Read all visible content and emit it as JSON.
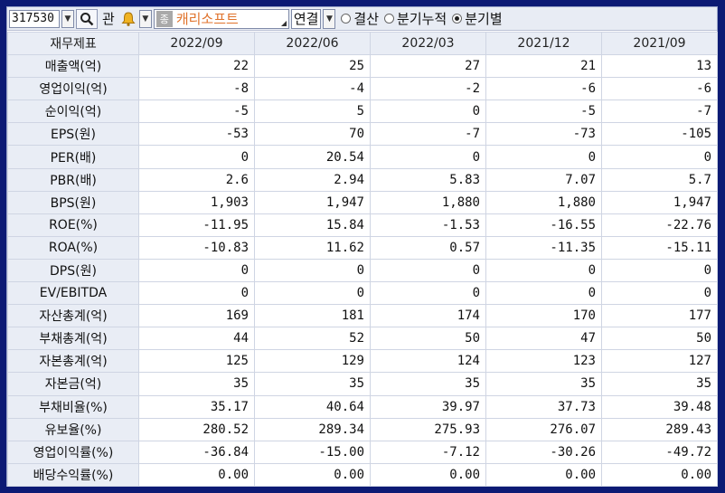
{
  "toolbar": {
    "stock_code": "317530",
    "gwan_label": "관",
    "tag_label": "종",
    "company_name": "캐리소프트",
    "consolidated_label": "연결",
    "radio_options": [
      {
        "label": "결산",
        "selected": false
      },
      {
        "label": "분기누적",
        "selected": false
      },
      {
        "label": "분기별",
        "selected": true
      }
    ]
  },
  "table": {
    "header_label": "재무제표",
    "periods": [
      "2022/09",
      "2022/06",
      "2022/03",
      "2021/12",
      "2021/09"
    ],
    "rows": [
      {
        "label": "매출액(억)",
        "values": [
          "22",
          "25",
          "27",
          "21",
          "13"
        ]
      },
      {
        "label": "영업이익(억)",
        "values": [
          "-8",
          "-4",
          "-2",
          "-6",
          "-6"
        ]
      },
      {
        "label": "순이익(억)",
        "values": [
          "-5",
          "5",
          "0",
          "-5",
          "-7"
        ]
      },
      {
        "label": "EPS(원)",
        "values": [
          "-53",
          "70",
          "-7",
          "-73",
          "-105"
        ]
      },
      {
        "label": "PER(배)",
        "values": [
          "0",
          "20.54",
          "0",
          "0",
          "0"
        ]
      },
      {
        "label": "PBR(배)",
        "values": [
          "2.6",
          "2.94",
          "5.83",
          "7.07",
          "5.7"
        ]
      },
      {
        "label": "BPS(원)",
        "values": [
          "1,903",
          "1,947",
          "1,880",
          "1,880",
          "1,947"
        ]
      },
      {
        "label": "ROE(%)",
        "values": [
          "-11.95",
          "15.84",
          "-1.53",
          "-16.55",
          "-22.76"
        ]
      },
      {
        "label": "ROA(%)",
        "values": [
          "-10.83",
          "11.62",
          "0.57",
          "-11.35",
          "-15.11"
        ]
      },
      {
        "label": "DPS(원)",
        "values": [
          "0",
          "0",
          "0",
          "0",
          "0"
        ]
      },
      {
        "label": "EV/EBITDA",
        "values": [
          "0",
          "0",
          "0",
          "0",
          "0"
        ]
      },
      {
        "label": "자산총계(억)",
        "values": [
          "169",
          "181",
          "174",
          "170",
          "177"
        ]
      },
      {
        "label": "부채총계(억)",
        "values": [
          "44",
          "52",
          "50",
          "47",
          "50"
        ]
      },
      {
        "label": "자본총계(억)",
        "values": [
          "125",
          "129",
          "124",
          "123",
          "127"
        ]
      },
      {
        "label": "자본금(억)",
        "values": [
          "35",
          "35",
          "35",
          "35",
          "35"
        ]
      },
      {
        "label": "부채비율(%)",
        "values": [
          "35.17",
          "40.64",
          "39.97",
          "37.73",
          "39.48"
        ]
      },
      {
        "label": "유보율(%)",
        "values": [
          "280.52",
          "289.34",
          "275.93",
          "276.07",
          "289.43"
        ]
      },
      {
        "label": "영업이익률(%)",
        "values": [
          "-36.84",
          "-15.00",
          "-7.12",
          "-30.26",
          "-49.72"
        ]
      },
      {
        "label": "배당수익률(%)",
        "values": [
          "0.00",
          "0.00",
          "0.00",
          "0.00",
          "0.00"
        ]
      }
    ]
  }
}
